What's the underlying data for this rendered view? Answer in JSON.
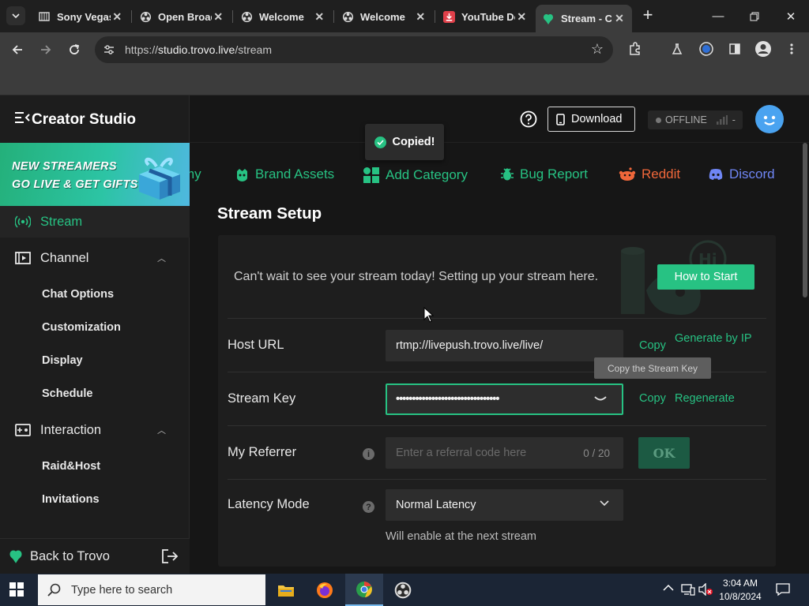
{
  "browser": {
    "tabs": [
      {
        "title": "Sony Vegas",
        "icon": "sony-vegas-icon"
      },
      {
        "title": "Open Broadcaster",
        "icon": "obs-icon"
      },
      {
        "title": "Welcome",
        "icon": "obs-icon"
      },
      {
        "title": "Welcome",
        "icon": "obs-icon"
      },
      {
        "title": "YouTube Downloader",
        "icon": "youtube-download-icon"
      },
      {
        "title": "Stream - Creator Studio",
        "icon": "trovo-icon",
        "active": true
      }
    ],
    "url_scheme": "https://",
    "url_host": "studio.trovo.live",
    "url_path": "/stream"
  },
  "sidebar": {
    "brand": "Creator Studio",
    "promo_line1": "NEW STREAMERS",
    "promo_line2": "GO LIVE & GET GIFTS",
    "nav": [
      {
        "label": "Stream",
        "icon": "broadcast-icon",
        "active": true
      },
      {
        "label": "Channel",
        "icon": "play-box-icon",
        "expanded": true,
        "children": [
          "Chat Options",
          "Customization",
          "Display",
          "Schedule"
        ]
      },
      {
        "label": "Interaction",
        "icon": "interaction-icon",
        "expanded": true,
        "children": [
          "Raid&Host",
          "Invitations"
        ]
      }
    ],
    "back_label": "Back to Trovo"
  },
  "header": {
    "download_label": "Download",
    "status_label": "OFFLINE",
    "status_extra": "-",
    "toast": "Copied!"
  },
  "links": [
    {
      "label": "my",
      "icon": "academy-icon",
      "color": "#27c283"
    },
    {
      "label": "Brand Assets",
      "icon": "brand-assets-icon",
      "color": "#27c283"
    },
    {
      "label": "Add Category",
      "icon": "add-category-icon",
      "color": "#27c283"
    },
    {
      "label": "Bug Report",
      "icon": "bug-icon",
      "color": "#27c283"
    },
    {
      "label": "Reddit",
      "icon": "reddit-icon",
      "color": "#f0673a"
    },
    {
      "label": "Discord",
      "icon": "discord-icon",
      "color": "#6f86f5"
    }
  ],
  "stream_setup": {
    "title": "Stream Setup",
    "intro": "Can't wait to see your stream today! Setting up your stream here.",
    "how_to_start": "How to Start",
    "host_url": {
      "label": "Host URL",
      "value": "rtmp://livepush.trovo.live/live/",
      "copy": "Copy",
      "alt_action": "Generate by IP"
    },
    "stream_key": {
      "label": "Stream Key",
      "value": "••••••••••••••••••••••••••••••••",
      "copy": "Copy",
      "alt_action": "Regenerate",
      "tooltip": "Copy the Stream Key"
    },
    "referrer": {
      "label": "My Referrer",
      "placeholder": "Enter a referral code here",
      "count": "0 / 20",
      "ok": "OK"
    },
    "latency": {
      "label": "Latency Mode",
      "value": "Normal Latency",
      "hint": "Will enable at the next stream"
    }
  },
  "taskbar": {
    "search_placeholder": "Type here to search",
    "time": "3:04 AM",
    "date": "10/8/2024"
  },
  "colors": {
    "accent": "#27c283",
    "reddit": "#f0673a",
    "discord": "#6f86f5"
  }
}
